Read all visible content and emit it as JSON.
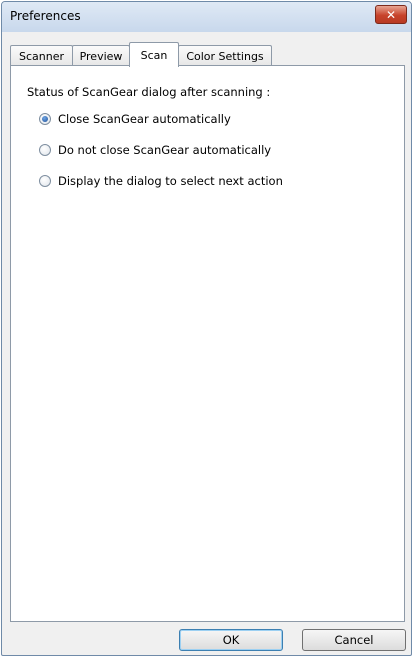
{
  "window": {
    "title": "Preferences",
    "close_symbol": "✕"
  },
  "tabs": [
    {
      "label": "Scanner",
      "active": false
    },
    {
      "label": "Preview",
      "active": false
    },
    {
      "label": "Scan",
      "active": true
    },
    {
      "label": "Color Settings",
      "active": false
    }
  ],
  "scan_tab": {
    "status_label": "Status of ScanGear dialog after scanning :",
    "options": [
      {
        "label": "Close ScanGear automatically",
        "selected": true
      },
      {
        "label": "Do not close ScanGear automatically",
        "selected": false
      },
      {
        "label": "Display the dialog to select next action",
        "selected": false
      }
    ]
  },
  "buttons": {
    "ok_label": "OK",
    "cancel_label": "Cancel"
  },
  "icons": {
    "close": "close-icon",
    "radio": "radio-button-icon"
  },
  "colors": {
    "close_button": "#c7432b",
    "titlebar": "#c8d8ec",
    "radio_selected": "#1f4f96"
  }
}
